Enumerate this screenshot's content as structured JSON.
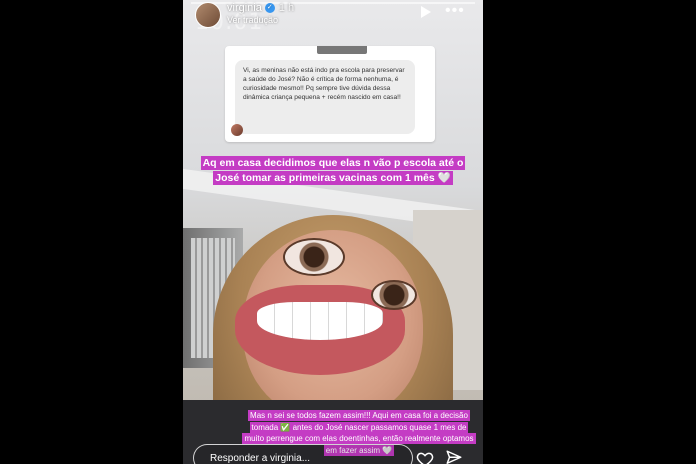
{
  "story": {
    "username": "virginia",
    "time_ago": "1 h",
    "translation_link": "Ver tradução",
    "watermark_clock": "10:01",
    "question_text": "Vi, as meninas não está indo pra escola para preservar a saúde do José? Não é crítica de forma nenhuma, é curiosidade mesmo!! Pq sempre tive dúvida dessa dinâmica criança pequena + recém nascido em casa!!",
    "caption_top": "Aq em casa decidimos que elas n vão p escola até o José tomar as primeiras vacinas com 1 mês 🤍",
    "caption_bottom": "Mas n sei se todos fazem assim!!! Aqui em casa foi a decisão tomada ✅ antes do José nascer passamos quase 1 mes de muito perrengue com elas doentinhas, então realmente optamos em fazer assim 🤍",
    "reply_placeholder": "Responder a virginia..."
  },
  "icons": {
    "verified": "verified-badge-icon",
    "play": "play-icon",
    "more": "more-options-icon",
    "heart": "heart-icon",
    "send": "send-icon"
  },
  "colors": {
    "caption_highlight": "#c43cc4",
    "verified_blue": "#3897f0"
  }
}
